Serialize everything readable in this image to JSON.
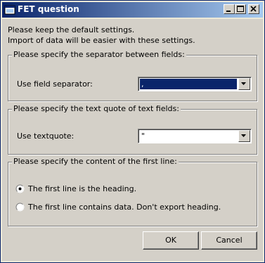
{
  "window": {
    "title": "FET question",
    "minimize_icon": "minimize-icon",
    "maximize_icon": "maximize-icon",
    "close_icon": "close-icon"
  },
  "intro": {
    "line1": "Please keep the default settings.",
    "line2": "Import of data will be easier with these settings."
  },
  "separator_group": {
    "legend": "Please specify the separator between fields:",
    "label": "Use field separator:",
    "value": ","
  },
  "quote_group": {
    "legend": "Please specify the text quote of text fields:",
    "label": "Use textquote:",
    "value": "\""
  },
  "first_line_group": {
    "legend": "Please specify the content of the first line:",
    "options": [
      {
        "label": "The first line is the heading.",
        "checked": true
      },
      {
        "label": "The first line contains data. Don't export heading.",
        "checked": false
      }
    ]
  },
  "buttons": {
    "ok": "OK",
    "cancel": "Cancel"
  },
  "colors": {
    "title_bar": "#0a246a",
    "selection": "#0a246a",
    "face": "#d4d0c8"
  }
}
